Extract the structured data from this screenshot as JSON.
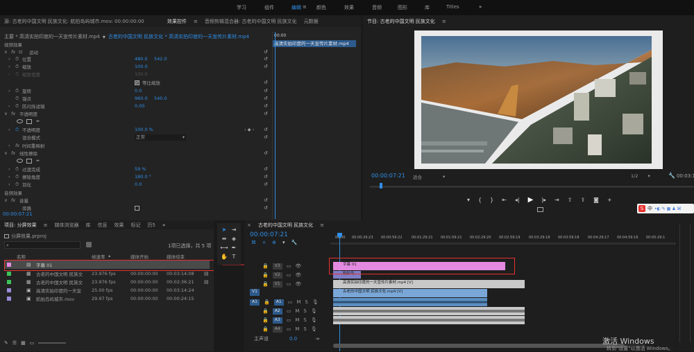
{
  "workspace_tabs": [
    "学习",
    "组件",
    "编辑",
    "颜色",
    "效果",
    "音频",
    "图形",
    "库",
    "Titles"
  ],
  "workspace_selected": "编辑",
  "workspace_more": "»",
  "source": {
    "title": "源: 古老的中国文明 民族文化: 航拍岛屿城市.mov: 00:00:00:00",
    "tabs": [
      "效果控件",
      "音频剪辑混合器: 古老的中国文明 民族文化",
      "元数据"
    ],
    "clip_path_prefix": "主要 * 高清实拍印度的一天宣传片素材.mp4",
    "clip_path_seq": "古老的中国文明 民族文化 * 高清实拍印度的一天宣传片素材.mp4",
    "mini_time": "00:00",
    "mini_clip": "高清实拍印度的一天宣传片素材.mp4",
    "timecode": "00:00:07:21"
  },
  "effects": {
    "video_section": "视频效果",
    "motion": "运动",
    "position": {
      "label": "位置",
      "x": "480.0",
      "y": "542.0"
    },
    "scale": {
      "label": "缩放",
      "value": "100.0"
    },
    "scale_width": {
      "label": "缩放宽度",
      "value": "100.0"
    },
    "uniform_scale": "等比缩放",
    "rotation": {
      "label": "旋转",
      "value": "0.0"
    },
    "anchor": {
      "label": "锚点",
      "x": "960.0",
      "y": "540.0"
    },
    "anti_flicker": {
      "label": "防闪烁滤镜",
      "value": "0.00"
    },
    "opacity_section": "不透明度",
    "opacity": {
      "label": "不透明度",
      "value": "100.0 %"
    },
    "blend_mode": {
      "label": "混合模式",
      "value": "正常"
    },
    "time_remap": "时间重映射",
    "linear_wipe": "线性擦除",
    "transition_completion": {
      "label": "过渡完成",
      "value": "59 %"
    },
    "wipe_angle": {
      "label": "擦除角度",
      "value": "180.0 °"
    },
    "feather": {
      "label": "羽化",
      "value": "0.0"
    },
    "audio_section": "音频效果",
    "volume": "音量",
    "bypass": "旁路"
  },
  "program": {
    "title": "节目: 古老的中国文明 民族文化",
    "timecode": "00:00:07:21",
    "fit": "适合",
    "resolution": "1/2",
    "end_time": "00:03:1"
  },
  "project": {
    "tabs": [
      "项目: 分屏效果",
      "媒体浏览器",
      "库",
      "信息",
      "效果",
      "标记",
      "历5"
    ],
    "file": "分屏效果.prproj",
    "selection": "1项已选择，共 5 项",
    "columns": [
      "名称",
      "帧速率",
      "媒体开始",
      "媒体结束"
    ],
    "items": [
      {
        "name": "字幕 01",
        "fps": "",
        "start": "",
        "end": "",
        "color": "#e58ae0"
      },
      {
        "name": "古老的中国文明 民族文",
        "fps": "23.976 fps",
        "start": "00:00:00:00",
        "end": "00:03:14:08",
        "color": "#3ec25a"
      },
      {
        "name": "古老的中国文明 民族文",
        "fps": "23.976 fps",
        "start": "00:00:00:00",
        "end": "00:02:36:21",
        "color": "#3ec25a"
      },
      {
        "name": "高清实拍印度的一天宣",
        "fps": "25.00 fps",
        "start": "00:00:00:00",
        "end": "00:03:14:24",
        "color": "#9b8bd8"
      },
      {
        "name": "航拍岛屿城市.mov",
        "fps": "29.97 fps",
        "start": "00:00:00:00",
        "end": "00:00:24:15",
        "color": "#9b8bd8"
      }
    ]
  },
  "timeline": {
    "title": "古老的中国文明 民族文化",
    "timecode": "00:00:07:21",
    "ruler": [
      "00:00",
      "00:00:29:23",
      "00:00:59:22",
      "00:01:29:21",
      "00:01:59:21",
      "00:02:29:20",
      "00:02:59:19",
      "00:03:29:18",
      "00:03:59:18",
      "00:04:29:17",
      "00:04:59:16",
      "00:05:29:1"
    ],
    "tracks": [
      {
        "id": "V3",
        "kind": "video"
      },
      {
        "id": "V2",
        "kind": "video"
      },
      {
        "id": "V1",
        "kind": "video",
        "src": "V1"
      },
      {
        "id": "A1",
        "kind": "audio",
        "src": "A1"
      },
      {
        "id": "A2",
        "kind": "audio"
      },
      {
        "id": "A3",
        "kind": "audio"
      },
      {
        "id": "A4",
        "kind": "audio"
      }
    ],
    "master": {
      "label": "主声道",
      "value": "0.0"
    },
    "clips": {
      "title": "字幕 01",
      "v3_small": "航拍岛...",
      "v2": "高清实拍印度的一天宣传片素材.mp4 [V]",
      "v1": "古老的中国文明 民族文化.mp4 [V]"
    }
  },
  "windows_watermark": {
    "line1": "激活 Windows",
    "line2": "转到\"设置\"以激活 Windows。"
  },
  "colors": {
    "accent": "#2f8fe8",
    "title_clip": "#e48ae0",
    "red_box": "#e8302f"
  }
}
